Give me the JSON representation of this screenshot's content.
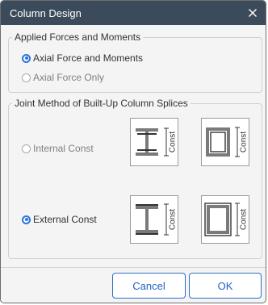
{
  "window": {
    "title": "Column Design",
    "close_glyph": "×"
  },
  "forces_group": {
    "legend": "Applied Forces and Moments",
    "options": [
      {
        "label": "Axial Force and Moments",
        "selected": true
      },
      {
        "label": "Axial Force Only",
        "selected": false
      }
    ]
  },
  "splice_group": {
    "legend": "Joint Method of Built-Up Column Splices",
    "options": [
      {
        "label": "Internal Const",
        "selected": false
      },
      {
        "label": "External Const",
        "selected": true
      }
    ],
    "diagram_label": "Const"
  },
  "buttons": {
    "cancel": "Cancel",
    "ok": "OK"
  },
  "colors": {
    "titlebar": "#3c4b5b",
    "accent": "#2d73dc",
    "steel": "#7a7a7a"
  },
  "icons": {
    "close": "close-icon",
    "h_section": "h-section-icon",
    "box_section": "box-section-icon",
    "radio": "radio-icon"
  }
}
